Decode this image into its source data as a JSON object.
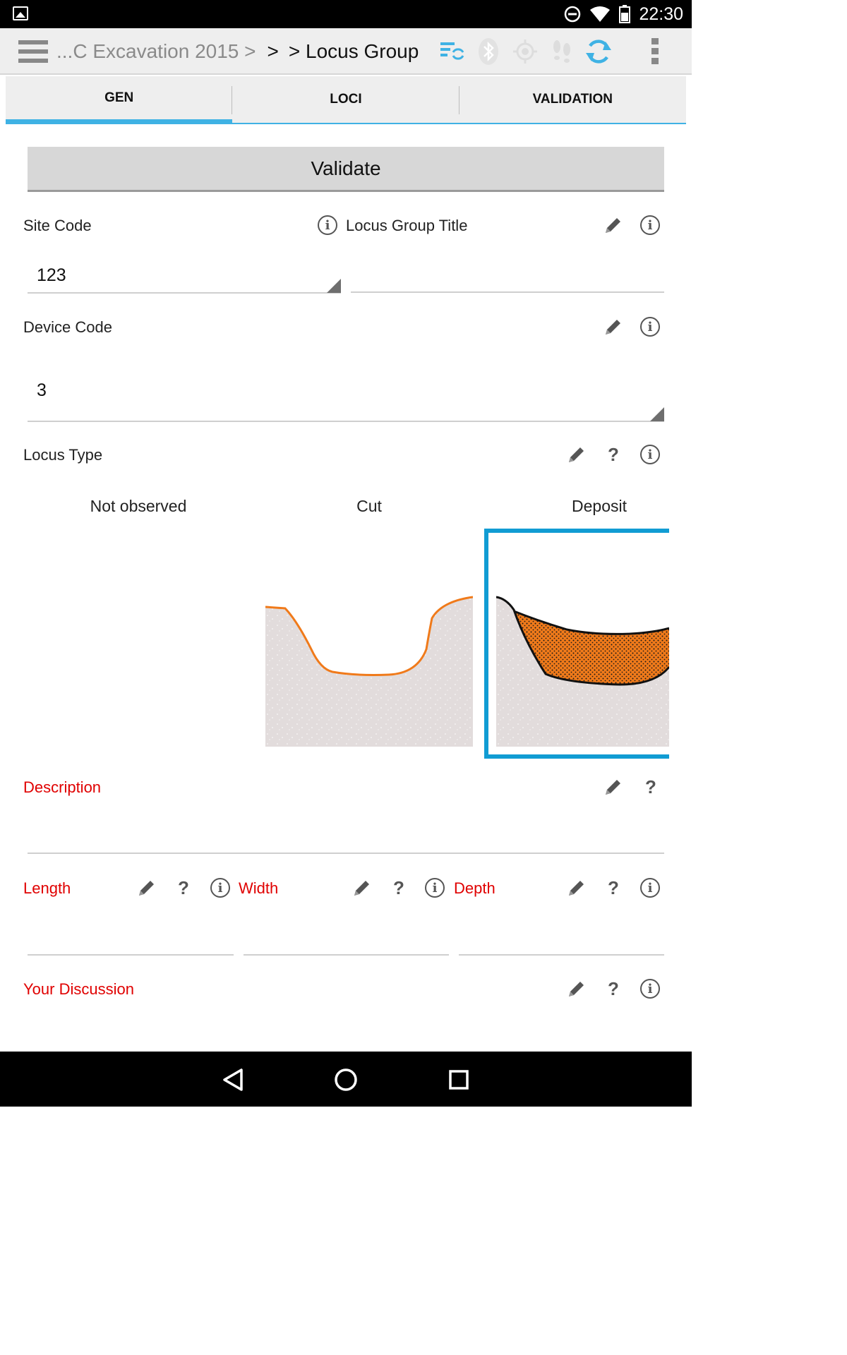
{
  "status_bar": {
    "time": "22:30",
    "icons": [
      "gallery-icon",
      "dnd-icon",
      "wifi-icon",
      "battery-icon"
    ]
  },
  "action_bar": {
    "breadcrumb_prefix": "...C Excavation 2015 >",
    "breadcrumb_sep": ">",
    "breadcrumb_current": "> Locus Group",
    "icons": [
      "sync-list-icon",
      "bluetooth-icon",
      "gps-icon",
      "footsteps-icon",
      "refresh-icon",
      "overflow-menu-icon"
    ],
    "accent": "#3fb2e4"
  },
  "tabs": [
    {
      "label": "GEN",
      "active": true
    },
    {
      "label": "LOCI",
      "active": false
    },
    {
      "label": "VALIDATION",
      "active": false
    }
  ],
  "form": {
    "validate_label": "Validate",
    "site_code": {
      "label": "Site Code",
      "value": "123"
    },
    "locus_group_title": {
      "label": "Locus Group Title",
      "value": ""
    },
    "device_code": {
      "label": "Device Code",
      "value": "3"
    },
    "locus_type": {
      "label": "Locus Type",
      "options": [
        "Not observed",
        "Cut",
        "Deposit"
      ],
      "selected": "Deposit"
    },
    "description": {
      "label": "Description",
      "value": ""
    },
    "length": {
      "label": "Length",
      "value": ""
    },
    "width": {
      "label": "Width",
      "value": ""
    },
    "depth": {
      "label": "Depth",
      "value": ""
    },
    "discussion": {
      "label": "Your Discussion",
      "value": ""
    },
    "help_glyph": "?",
    "info_glyph": "i",
    "required_color": "#e00000"
  },
  "nav_bar": {
    "icons": [
      "back-icon",
      "home-icon",
      "recents-icon"
    ]
  }
}
